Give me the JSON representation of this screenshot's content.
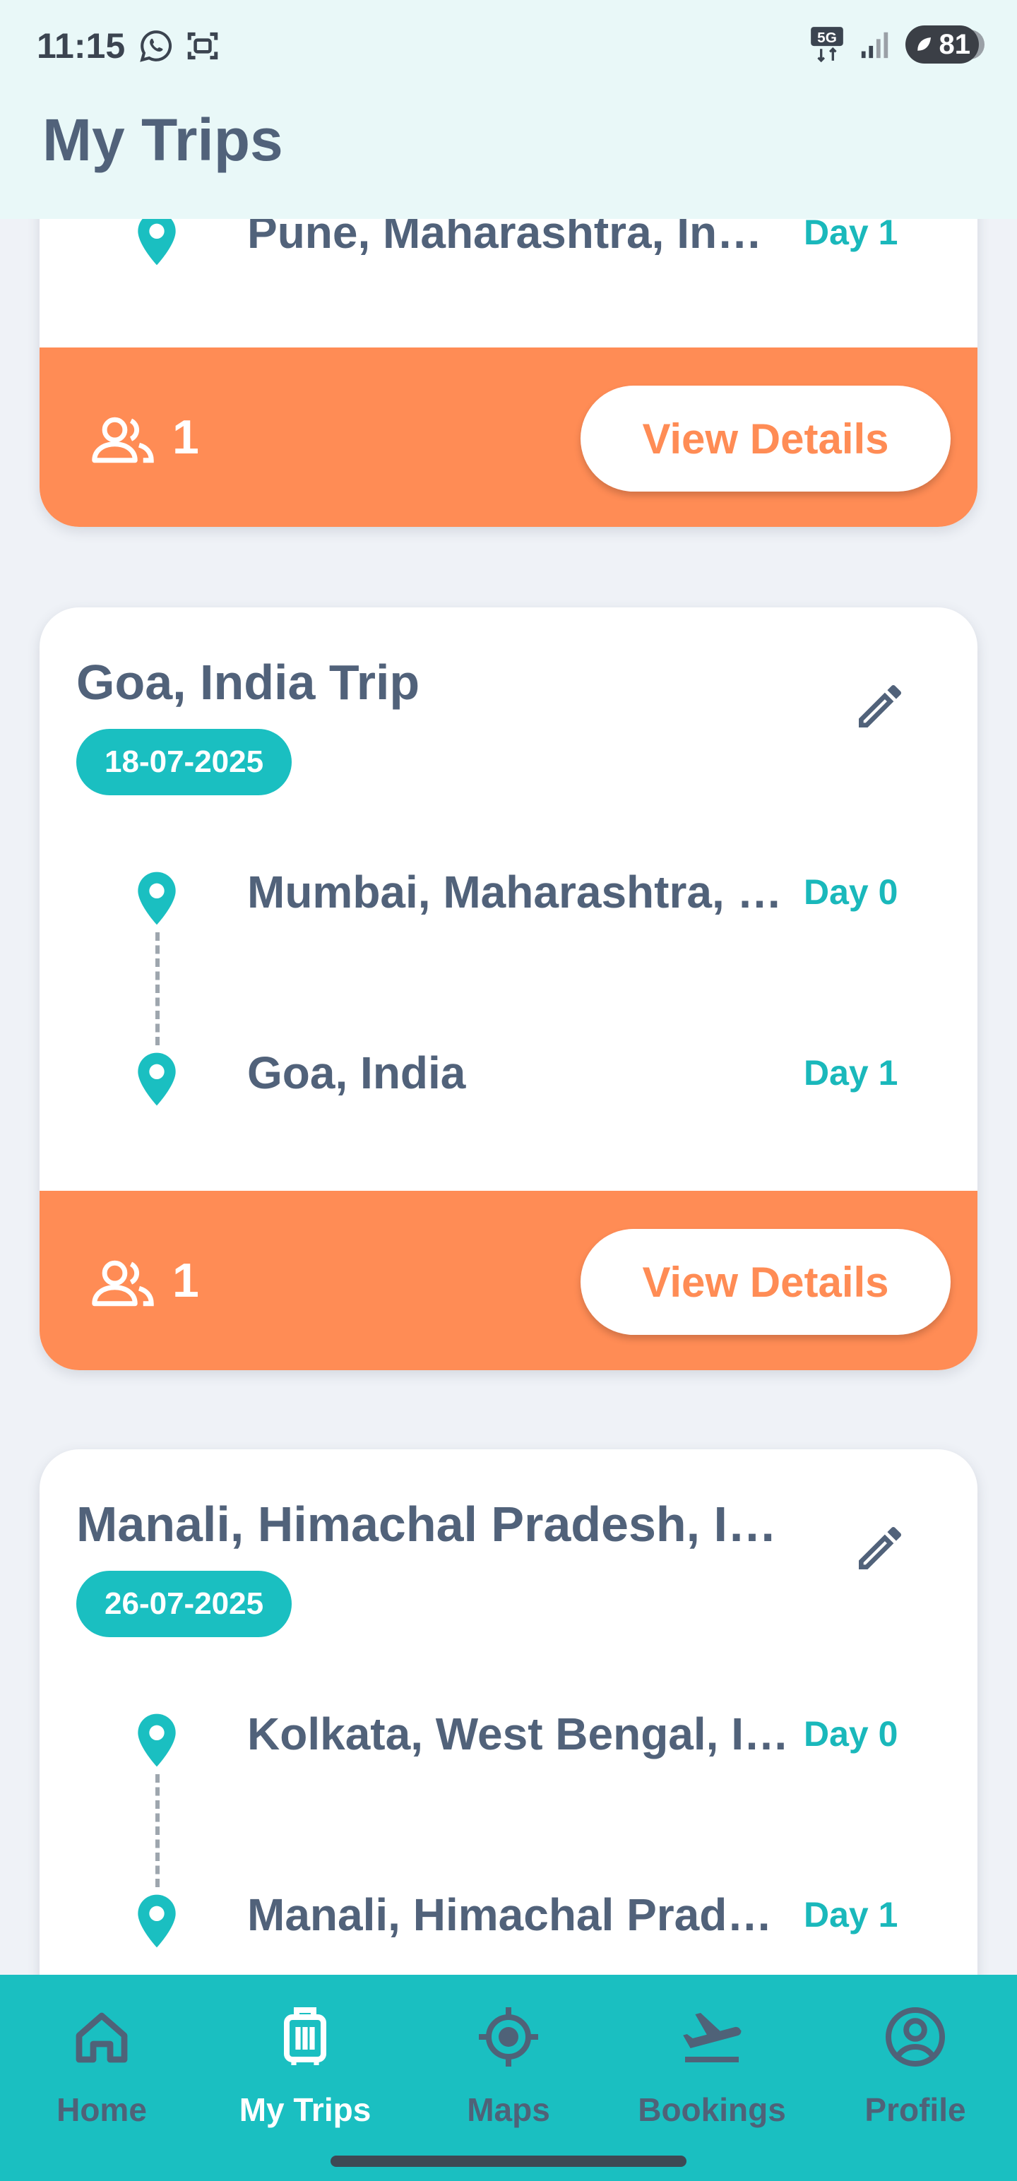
{
  "status_bar": {
    "time": "11:15",
    "network": "5G",
    "battery": "81"
  },
  "header": {
    "title": "My Trips"
  },
  "cards": [
    {
      "title": "",
      "date": "",
      "stops": [
        {
          "name": "Pune, Maharashtra, In…",
          "day": "Day 1"
        }
      ],
      "travelers": "1",
      "action": "View Details"
    },
    {
      "title": "Goa, India Trip",
      "date": "18-07-2025",
      "stops": [
        {
          "name": "Mumbai, Maharashtra, …",
          "day": "Day 0"
        },
        {
          "name": "Goa, India",
          "day": "Day 1"
        }
      ],
      "travelers": "1",
      "action": "View Details"
    },
    {
      "title": "Manali, Himachal Pradesh, I…",
      "date": "26-07-2025",
      "stops": [
        {
          "name": "Kolkata, West Bengal, I…",
          "day": "Day 0"
        },
        {
          "name": "Manali, Himachal Prad…",
          "day": "Day 1"
        }
      ]
    }
  ],
  "nav": [
    {
      "label": "Home",
      "icon": "home-icon",
      "active": false
    },
    {
      "label": "My Trips",
      "icon": "luggage-icon",
      "active": true
    },
    {
      "label": "Maps",
      "icon": "location-target-icon",
      "active": false
    },
    {
      "label": "Bookings",
      "icon": "flight-takeoff-icon",
      "active": false
    },
    {
      "label": "Profile",
      "icon": "account-circle-icon",
      "active": false
    }
  ],
  "colors": {
    "header_bg": "#e9f8f8",
    "page_bg": "#eff2f7",
    "accent_teal": "#1abfc1",
    "footer_orange": "#ff8c55",
    "text_slate": "#51627a"
  }
}
